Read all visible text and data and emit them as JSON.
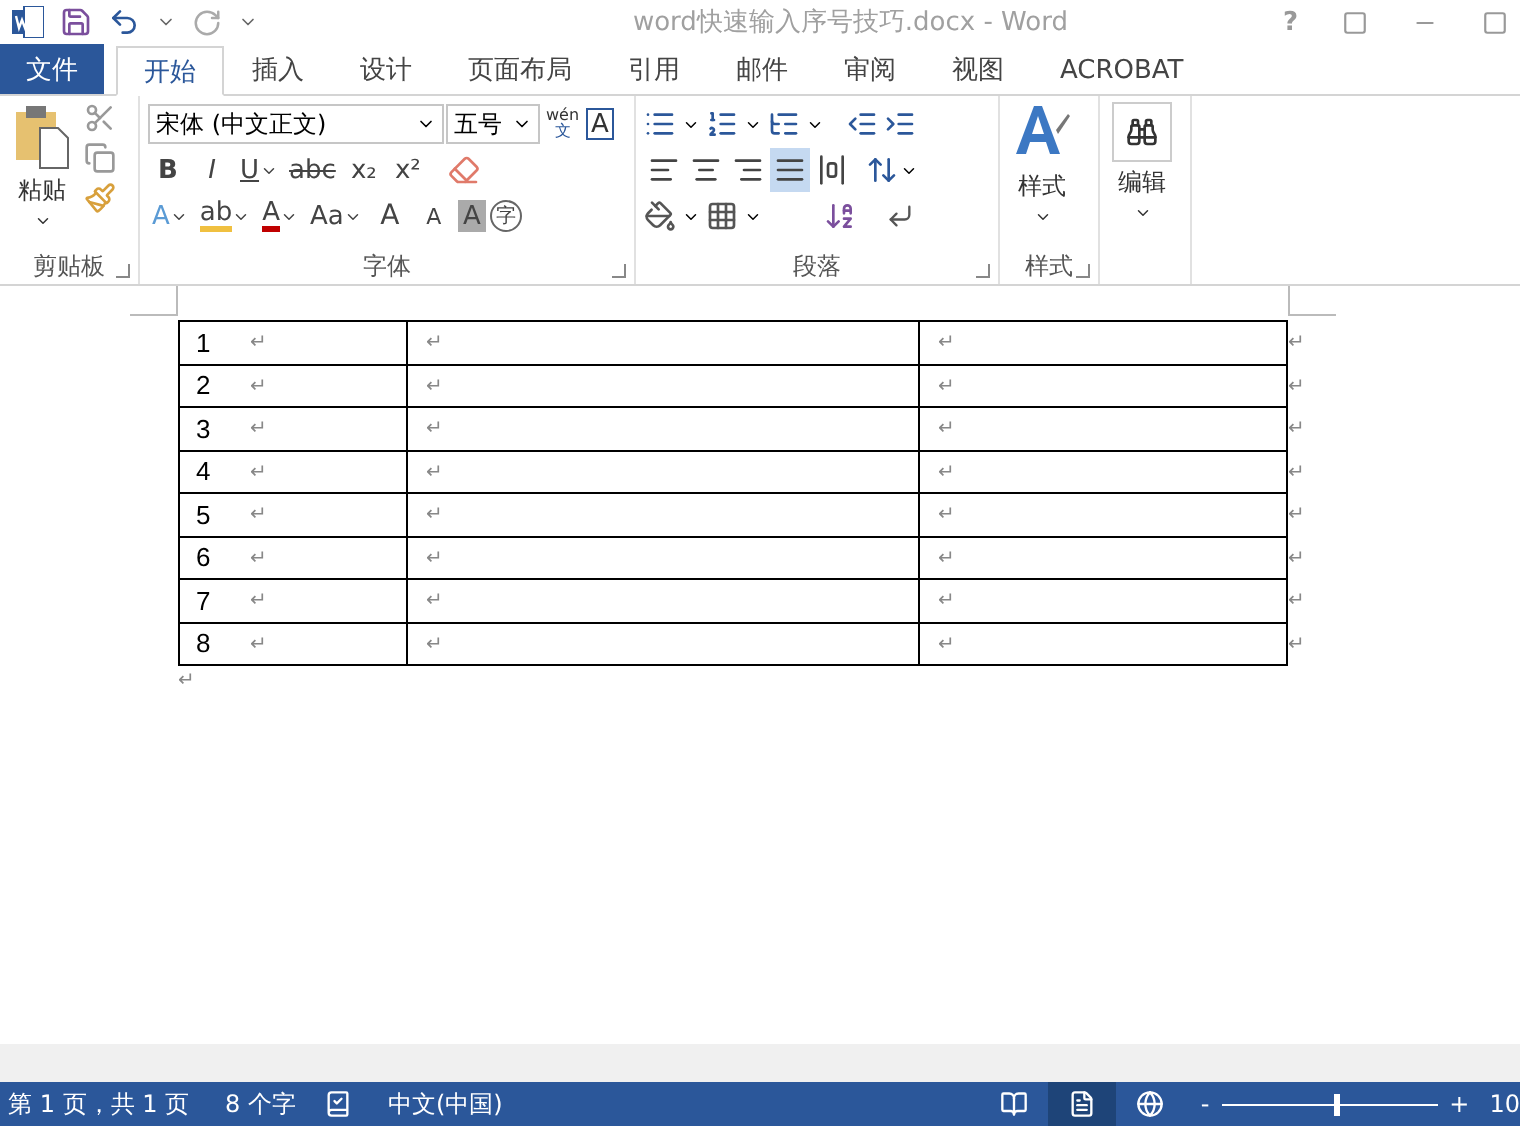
{
  "title_bar": {
    "title": "word快速输入序号技巧.docx - Word",
    "help": "?"
  },
  "tabs": [
    {
      "label": "文件",
      "kind": "file",
      "selected": false
    },
    {
      "label": "开始",
      "kind": "tab",
      "selected": true
    },
    {
      "label": "插入",
      "kind": "tab",
      "selected": false
    },
    {
      "label": "设计",
      "kind": "tab",
      "selected": false
    },
    {
      "label": "页面布局",
      "kind": "tab",
      "selected": false
    },
    {
      "label": "引用",
      "kind": "tab",
      "selected": false
    },
    {
      "label": "邮件",
      "kind": "tab",
      "selected": false
    },
    {
      "label": "审阅",
      "kind": "tab",
      "selected": false
    },
    {
      "label": "视图",
      "kind": "tab",
      "selected": false
    },
    {
      "label": "ACROBAT",
      "kind": "tab",
      "selected": false
    }
  ],
  "ribbon": {
    "clipboard": {
      "paste": "粘贴",
      "label": "剪贴板"
    },
    "font": {
      "font_name": "宋体 (中文正文)",
      "font_size": "五号",
      "phonetic_top": "wén",
      "phonetic_bottom": "文",
      "border_char": "A",
      "format_buttons": [
        {
          "text": "B",
          "kind": "bold",
          "dropdown": false
        },
        {
          "text": "I",
          "kind": "italic",
          "dropdown": false
        },
        {
          "text": "U",
          "kind": "underline",
          "dropdown": true
        },
        {
          "text": "abc",
          "kind": "strike",
          "dropdown": false
        },
        {
          "text": "x₂",
          "kind": "plain",
          "dropdown": false
        },
        {
          "text": "x²",
          "kind": "plain",
          "dropdown": false
        }
      ],
      "effect_buttons": [
        {
          "text": "A",
          "kind": "effects",
          "dropdown": true
        },
        {
          "text": "ab",
          "kind": "highlight",
          "dropdown": true
        },
        {
          "text": "A",
          "kind": "color",
          "dropdown": true
        },
        {
          "text": "Aa",
          "kind": "plain",
          "dropdown": true
        }
      ],
      "size_buttons": [
        {
          "text": "A",
          "kind": "grow"
        },
        {
          "text": "A",
          "kind": "shrink"
        }
      ],
      "shading_char": "A",
      "enclose_char": "字",
      "label": "字体"
    },
    "paragraph": {
      "alignments": [
        {
          "kind": "left",
          "selected": false
        },
        {
          "kind": "center",
          "selected": false
        },
        {
          "kind": "right",
          "selected": false
        },
        {
          "kind": "justify",
          "selected": true
        },
        {
          "kind": "distributed",
          "selected": false
        }
      ],
      "label": "段落"
    },
    "styles": {
      "button": "样式",
      "label": "样式"
    },
    "editing": {
      "button": "编辑"
    }
  },
  "document": {
    "rows": [
      {
        "cells": [
          {
            "text": "1",
            "mark": "↵"
          },
          {
            "mark": "↵"
          },
          {
            "mark": "↵"
          }
        ],
        "end_mark": "↵"
      },
      {
        "cells": [
          {
            "text": "2",
            "mark": "↵"
          },
          {
            "mark": "↵"
          },
          {
            "mark": "↵"
          }
        ],
        "end_mark": "↵"
      },
      {
        "cells": [
          {
            "text": "3",
            "mark": "↵"
          },
          {
            "mark": "↵"
          },
          {
            "mark": "↵"
          }
        ],
        "end_mark": "↵"
      },
      {
        "cells": [
          {
            "text": "4",
            "mark": "↵"
          },
          {
            "mark": "↵"
          },
          {
            "mark": "↵"
          }
        ],
        "end_mark": "↵"
      },
      {
        "cells": [
          {
            "text": "5",
            "mark": "↵"
          },
          {
            "mark": "↵"
          },
          {
            "mark": "↵"
          }
        ],
        "end_mark": "↵"
      },
      {
        "cells": [
          {
            "text": "6",
            "mark": "↵"
          },
          {
            "mark": "↵"
          },
          {
            "mark": "↵"
          }
        ],
        "end_mark": "↵"
      },
      {
        "cells": [
          {
            "text": "7",
            "mark": "↵"
          },
          {
            "mark": "↵"
          },
          {
            "mark": "↵"
          }
        ],
        "end_mark": "↵"
      },
      {
        "cells": [
          {
            "text": "8",
            "mark": "↵"
          },
          {
            "mark": "↵"
          },
          {
            "mark": "↵"
          }
        ],
        "end_mark": "↵"
      }
    ],
    "after_mark": "↵"
  },
  "status_bar": {
    "page": "第 1 页，共 1 页",
    "words": "8 个字",
    "language": "中文(中国)",
    "views": [
      {
        "kind": "read",
        "selected": false
      },
      {
        "kind": "print",
        "selected": true
      },
      {
        "kind": "web",
        "selected": false
      }
    ],
    "zoom_out": "-",
    "zoom_in": "+",
    "zoom": {
      "level": 0.53
    },
    "zoom_text": "10"
  }
}
